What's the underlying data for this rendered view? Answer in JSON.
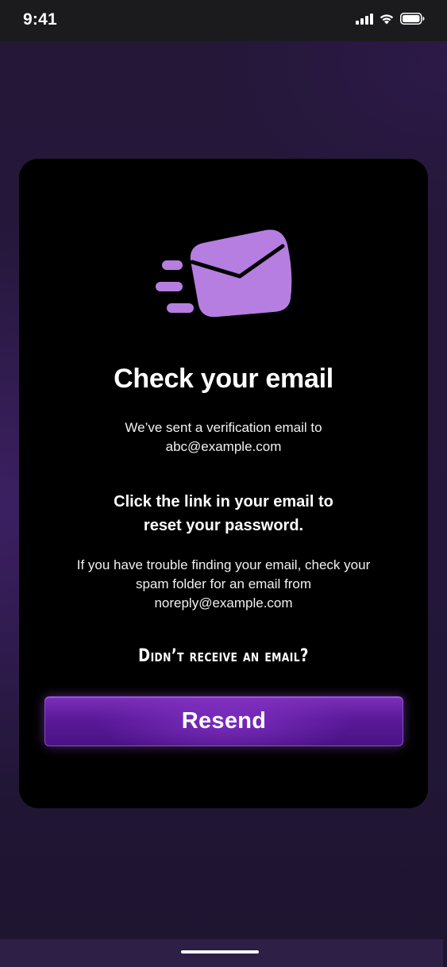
{
  "status_bar": {
    "time": "9:41",
    "icons": [
      "cellular-signal-icon",
      "wifi-icon",
      "battery-icon"
    ]
  },
  "card": {
    "illustration": "flying-envelope-icon",
    "title": "Check your email",
    "sent_line_1": "We’ve sent a verification email to",
    "sent_email": "abc@example.com",
    "instruction_line_1": "Click the link in your email to",
    "instruction_line_2": "reset your password.",
    "trouble_line_1": "If you have trouble finding your email, check your",
    "trouble_line_2": "spam folder for an email from",
    "trouble_line_3": "noreply@example.com",
    "didnt_receive": "Didn’t receive an email?",
    "resend_label": "Resend"
  },
  "colors": {
    "accent_purple": "#b57ee0",
    "button_purple": "#5a1a9a",
    "card_background": "#000000",
    "page_background": "#241738"
  }
}
